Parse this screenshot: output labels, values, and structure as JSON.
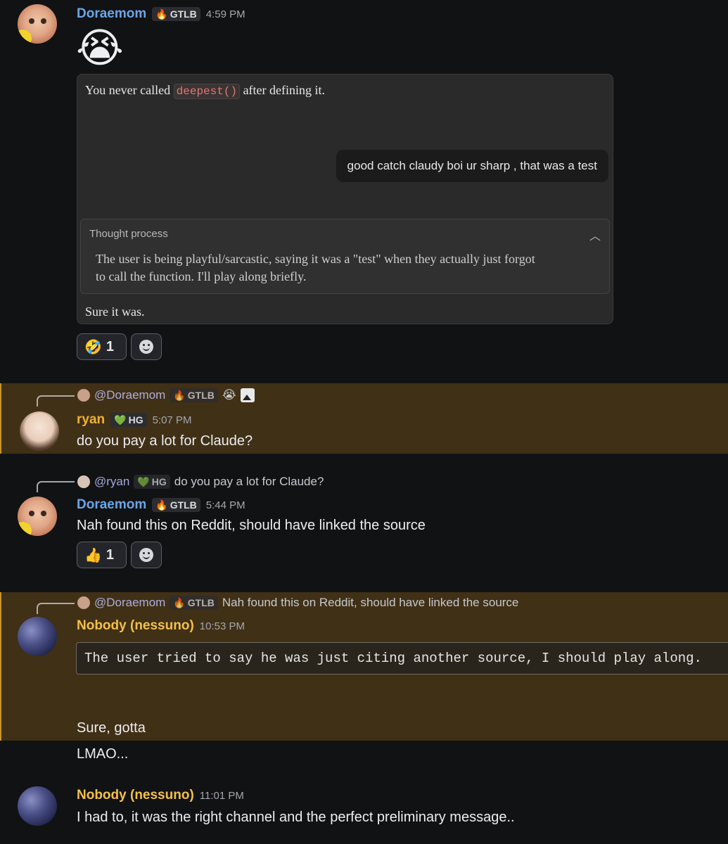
{
  "msg1": {
    "author": "Doraemom",
    "tag": "GTLB",
    "time": "4:59 PM",
    "emoji": "😭",
    "embed": {
      "line_before": "You never called",
      "code": "deepest()",
      "line_after": "after defining it.",
      "bubble": "good catch claudy boi ur sharp , that was a test",
      "thought_title": "Thought process",
      "thought_text_1": "The user is being playful/sarcastic, saying it was a \"test\" when they actually just forgot",
      "thought_text_2": "to call the function. I'll play along briefly.",
      "reply": "Sure it was."
    },
    "reaction_emoji": "🤣",
    "reaction_count": "1"
  },
  "msg2": {
    "reply_to": "@Doraemom",
    "reply_tag": "GTLB",
    "reply_emoji": "😭",
    "author": "ryan",
    "tag": "HG",
    "time": "5:07 PM",
    "text": "do you pay a lot for Claude?"
  },
  "msg3": {
    "reply_to": "@ryan",
    "reply_tag": "HG",
    "reply_text": "do you pay a lot for Claude?",
    "author": "Doraemom",
    "tag": "GTLB",
    "time": "5:44 PM",
    "text": "Nah found this on Reddit, should have linked the source",
    "reaction_emoji": "👍",
    "reaction_count": "1"
  },
  "msg4": {
    "reply_to": "@Doraemom",
    "reply_tag": "GTLB",
    "reply_text": "Nah found this on Reddit, should have linked the source",
    "author": "Nobody (nessuno)",
    "time": "10:53 PM",
    "code_block": "The user tried to say he was just citing another source, I should play along.",
    "text": "Sure, gotta",
    "followup": "LMAO..."
  },
  "msg5": {
    "author": "Nobody (nessuno)",
    "time": "11:01 PM",
    "text": "I had to, it was the right channel and the perfect preliminary message.."
  }
}
